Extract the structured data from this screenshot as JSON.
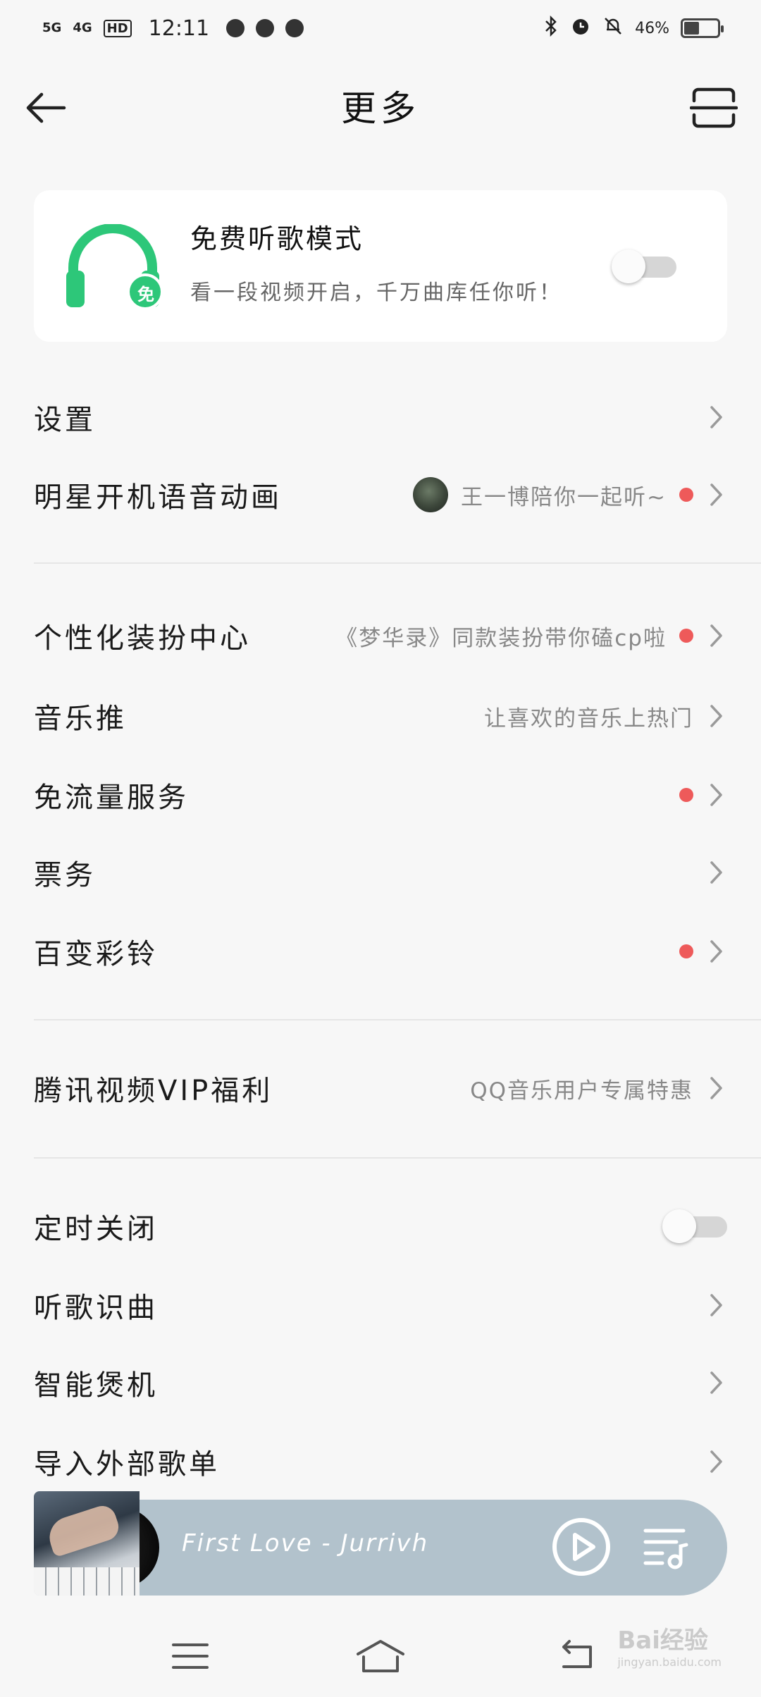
{
  "status_bar": {
    "signal_1": "5G",
    "signal_2": "4G",
    "hd_badge": "HD",
    "time": "12:11",
    "battery_percent": "46%",
    "battery_level": 0.46
  },
  "header": {
    "title": "更多"
  },
  "free_mode": {
    "title": "免费听歌模式",
    "subtitle": "看一段视频开启，千万曲库任你听！",
    "badge": "免",
    "enabled": false,
    "icon_color": "#2dc779"
  },
  "section1": [
    {
      "label": "设置",
      "hint": "",
      "dot": false
    },
    {
      "label": "明星开机语音动画",
      "hint": "王一博陪你一起听~",
      "dot": true,
      "avatar": true
    }
  ],
  "section2": [
    {
      "label": "个性化装扮中心",
      "hint": "《梦华录》同款装扮带你磕cp啦",
      "dot": true
    },
    {
      "label": "音乐推",
      "hint": "让喜欢的音乐上热门",
      "dot": false
    },
    {
      "label": "免流量服务",
      "hint": "",
      "dot": true
    },
    {
      "label": "票务",
      "hint": "",
      "dot": false
    },
    {
      "label": "百变彩铃",
      "hint": "",
      "dot": true
    }
  ],
  "section3": [
    {
      "label": "腾讯视频VIP福利",
      "hint": "QQ音乐用户专属特惠",
      "dot": false
    }
  ],
  "section4": {
    "timer_label": "定时关闭",
    "timer_enabled": false,
    "items": [
      {
        "label": "听歌识曲"
      },
      {
        "label": "智能煲机"
      },
      {
        "label": "导入外部歌单"
      }
    ]
  },
  "player": {
    "song": "First Love - Jurrivh",
    "bg_color": "#b2c2cc"
  },
  "watermark": {
    "brand": "Bai经验",
    "url": "jingyan.baidu.com"
  },
  "colors": {
    "accent_green": "#2dc779",
    "red_dot": "#ee5a5a",
    "background": "#f7f7f7"
  }
}
